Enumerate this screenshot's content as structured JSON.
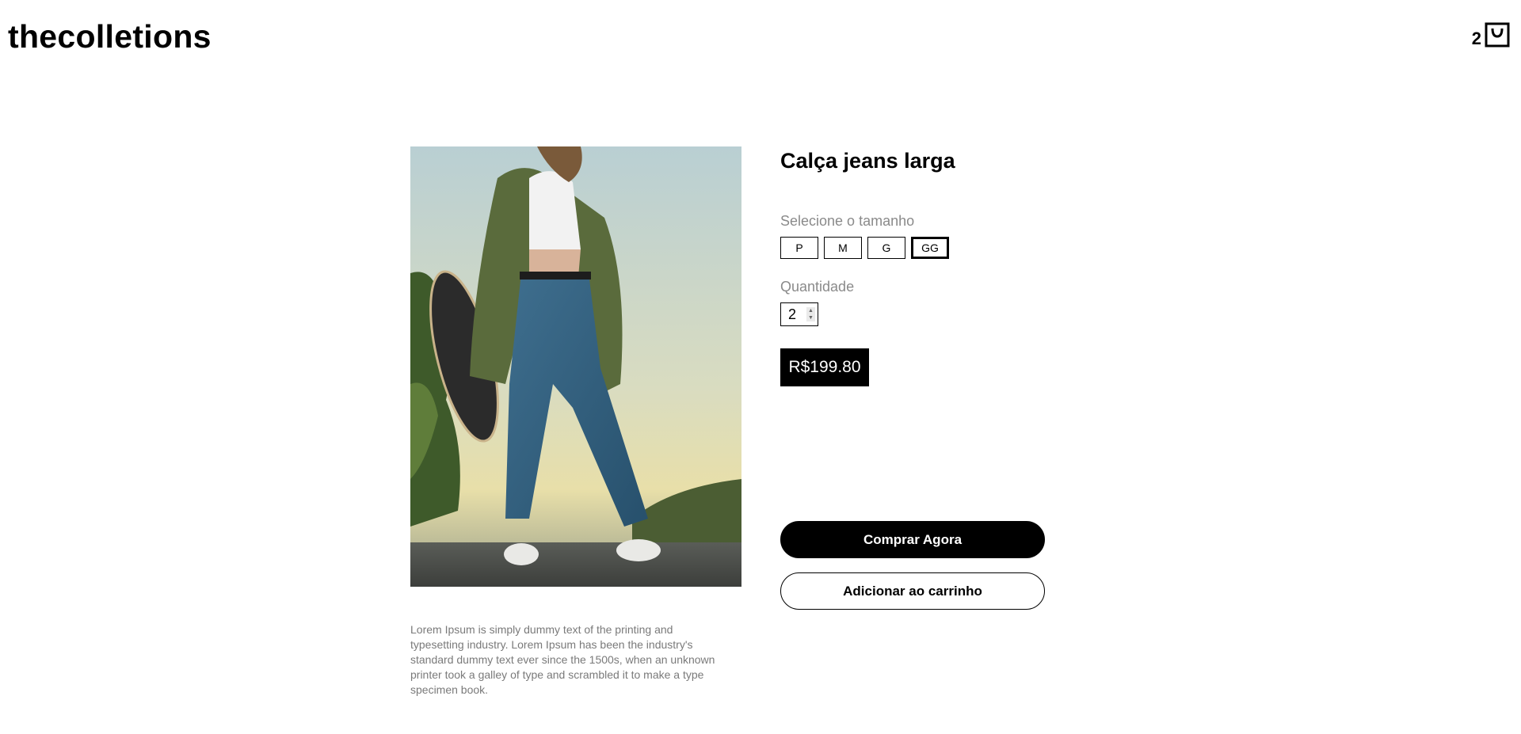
{
  "header": {
    "brand": "thecolletions",
    "cart_count": "2",
    "cart_icon": "shopping-bag-icon"
  },
  "product": {
    "image_alt": "Woman in wide-leg jeans holding a skateboard",
    "title": "Calça jeans larga",
    "description": "Lorem Ipsum is simply dummy text of the printing and typesetting industry. Lorem Ipsum has been the industry's standard dummy text ever since the 1500s, when an unknown printer took a galley of type and scrambled it to make a type specimen book.",
    "size_label": "Selecione o tamanho",
    "sizes": [
      "P",
      "M",
      "G",
      "GG"
    ],
    "selected_size": "GG",
    "quantity_label": "Quantidade",
    "quantity": "2",
    "price": "R$199.80",
    "buy_now_label": "Comprar Agora",
    "add_to_cart_label": "Adicionar ao carrinho"
  }
}
